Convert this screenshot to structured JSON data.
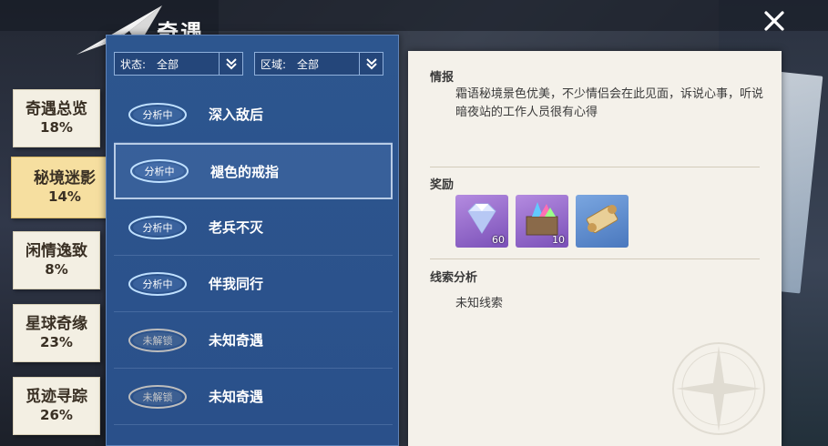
{
  "header": {
    "title": "奇遇"
  },
  "categories": [
    {
      "name": "奇遇总览",
      "percent": "18%"
    },
    {
      "name": "秘境迷影",
      "percent": "14%"
    },
    {
      "name": "闲情逸致",
      "percent": "8%"
    },
    {
      "name": "星球奇缘",
      "percent": "23%"
    },
    {
      "name": "觅迹寻踪",
      "percent": "26%"
    }
  ],
  "filters": {
    "state": {
      "label": "状态:",
      "value": "全部"
    },
    "region": {
      "label": "区域:",
      "value": "全部"
    }
  },
  "encounters": [
    {
      "status": "分析中",
      "name": "深入敌后"
    },
    {
      "status": "分析中",
      "name": "褪色的戒指"
    },
    {
      "status": "分析中",
      "name": "老兵不灭"
    },
    {
      "status": "分析中",
      "name": "伴我同行"
    },
    {
      "status": "未解锁",
      "name": "未知奇遇"
    },
    {
      "status": "未解锁",
      "name": "未知奇遇"
    }
  ],
  "detail": {
    "intel_title": "情报",
    "intel_text": "霜语秘境景色优美，不少情侣会在此见面，诉说心事，听说暗夜站的工作人员很有心得",
    "reward_title": "奖励",
    "rewards": [
      {
        "icon": "diamond-icon",
        "quantity": "60"
      },
      {
        "icon": "crystal-box-icon",
        "quantity": "10"
      },
      {
        "icon": "scroll-icon",
        "quantity": ""
      }
    ],
    "clue_title": "线索分析",
    "clue_text": "未知线索"
  },
  "colors": {
    "list_bg": "#2d568f",
    "active_tab": "#f6dfa0",
    "tab": "#f3efe3",
    "detail_bg": "#f4f1ea"
  }
}
